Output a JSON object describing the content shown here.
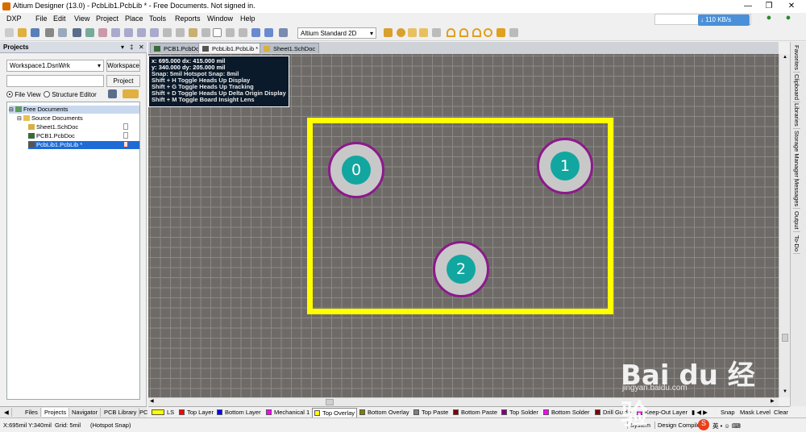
{
  "window": {
    "title": "Altium Designer (13.0) - PcbLib1.PcbLib * - Free Documents. Not signed in."
  },
  "menu": [
    "DXP",
    "File",
    "Edit",
    "View",
    "Project",
    "Place",
    "Tools",
    "Reports",
    "Window",
    "Help"
  ],
  "toolbar": {
    "view_mode": "Altium Standard 2D",
    "net_speed": "110 KB/s"
  },
  "projects_panel": {
    "title": "Projects",
    "workspace_value": "Workspace1.DsnWrk",
    "workspace_button": "Workspace",
    "project_button": "Project",
    "view_file": "File View",
    "view_structure": "Structure Editor",
    "tree": [
      {
        "label": "Free Documents",
        "level": 0,
        "selected": false
      },
      {
        "label": "Source Documents",
        "level": 1,
        "selected": false
      },
      {
        "label": "Sheet1.SchDoc",
        "level": 2,
        "selected": false
      },
      {
        "label": "PCB1.PcbDoc",
        "level": 2,
        "selected": false
      },
      {
        "label": "PcbLib1.PcbLib *",
        "level": 2,
        "selected": true
      }
    ]
  },
  "panel_tabs": [
    "Files",
    "Projects",
    "Navigator",
    "PCB Library",
    "PC"
  ],
  "doc_tabs": [
    {
      "label": "PCB1.PcbDoc",
      "active": false
    },
    {
      "label": "PcbLib1.PcbLib *",
      "active": true
    },
    {
      "label": "Sheet1.SchDoc",
      "active": false
    }
  ],
  "hud": {
    "line1": "x:  695.000   dx:   415.000 mil",
    "line2": "y:  340.000   dy:   205.000 mil",
    "line3": "Snap: 5mil Hotspot Snap: 8mil",
    "line4": "Shift + H   Toggle Heads Up Display",
    "line5": "Shift + G   Toggle Heads Up Tracking",
    "line6": "Shift + D   Toggle Heads Up Delta Origin Display",
    "line7": "Shift + M   Toggle Board Insight Lens"
  },
  "pads": [
    "0",
    "1",
    "2"
  ],
  "side_tabs": [
    "Favorites",
    "Clipboard",
    "Libraries",
    "Storage Manager",
    "Messages",
    "Output",
    "To-Do"
  ],
  "layers": [
    {
      "label": "LS",
      "color": "#ffff00"
    },
    {
      "label": "Top Layer",
      "color": "#ff0000"
    },
    {
      "label": "Bottom Layer",
      "color": "#0000ff"
    },
    {
      "label": "Mechanical 1",
      "color": "#ff00ff"
    },
    {
      "label": "Top Overlay",
      "color": "#ffff00"
    },
    {
      "label": "Bottom Overlay",
      "color": "#808000"
    },
    {
      "label": "Top Paste",
      "color": "#808080"
    },
    {
      "label": "Bottom Paste",
      "color": "#800000"
    },
    {
      "label": "Top Solder",
      "color": "#800080"
    },
    {
      "label": "Bottom Solder",
      "color": "#ff00ff"
    },
    {
      "label": "Drill Guide",
      "color": "#800000"
    },
    {
      "label": "Keep-Out Layer",
      "color": "#ff00ff"
    }
  ],
  "layer_controls": [
    "Snap",
    "Mask Level",
    "Clear"
  ],
  "status": {
    "coords": "X:695mil Y:340mil",
    "grid": "Grid: 5mil",
    "snap": "(Hotspot Snap)",
    "buttons": [
      "System",
      "Design Compiler"
    ]
  },
  "watermark": {
    "text": "Bai du 经验",
    "url": "jingyan.baidu.com"
  }
}
